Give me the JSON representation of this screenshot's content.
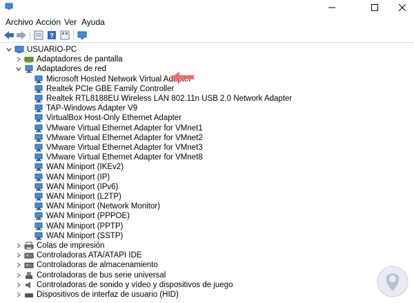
{
  "window": {
    "title": "",
    "controls": {
      "minimize": "minimize-icon",
      "maximize": "maximize-icon",
      "close": "close-icon"
    }
  },
  "menu": [
    "Archivo",
    "Acción",
    "Ver",
    "Ayuda"
  ],
  "toolbar": [
    "back-icon",
    "forward-icon",
    "properties-icon",
    "help-icon",
    "show-hide-icon",
    "scan-hardware-icon"
  ],
  "tree": {
    "root": "USUARIO-PC",
    "categories": [
      {
        "label": "Adaptadores de pantalla",
        "expanded": false,
        "icon": "display-adapter-icon"
      },
      {
        "label": "Adaptadores de red",
        "expanded": true,
        "icon": "network-adapter-icon",
        "children": [
          "Microsoft Hosted Network Virtual Adapter",
          "Realtek PCIe GBE Family Controller",
          "Realtek RTL8188EU Wireless LAN 802.11n USB 2.0 Network Adapter",
          "TAP-Windows Adapter V9",
          "VirtualBox Host-Only Ethernet Adapter",
          "VMware Virtual Ethernet Adapter for VMnet1",
          "VMware Virtual Ethernet Adapter for VMnet2",
          "VMware Virtual Ethernet Adapter for VMnet3",
          "VMware Virtual Ethernet Adapter for VMnet8",
          "WAN Miniport (IKEv2)",
          "WAN Miniport (IP)",
          "WAN Miniport (IPv6)",
          "WAN Miniport (L2TP)",
          "WAN Miniport (Network Monitor)",
          "WAN Miniport (PPPOE)",
          "WAN Miniport (PPTP)",
          "WAN Miniport (SSTP)"
        ]
      },
      {
        "label": "Colas de impresión",
        "expanded": false,
        "icon": "printer-icon"
      },
      {
        "label": "Controladoras ATA/ATAPI IDE",
        "expanded": false,
        "icon": "ide-controller-icon"
      },
      {
        "label": "Controladoras de almacenamiento",
        "expanded": false,
        "icon": "storage-controller-icon"
      },
      {
        "label": "Controladoras de bus serie universal",
        "expanded": false,
        "icon": "usb-icon"
      },
      {
        "label": "Controladoras de sonido y vídeo y dispositivos de juego",
        "expanded": false,
        "icon": "sound-icon"
      },
      {
        "label": "Dispositivos de interfaz de usuario (HID)",
        "expanded": false,
        "icon": "hid-icon"
      }
    ]
  },
  "annotation": {
    "arrow_color": "#f06b6b",
    "points_to": "Microsoft Hosted Network Virtual Adapter"
  },
  "colors": {
    "highlight_arrow": "#f06b6b",
    "network_icon": "#2b7bd6"
  }
}
